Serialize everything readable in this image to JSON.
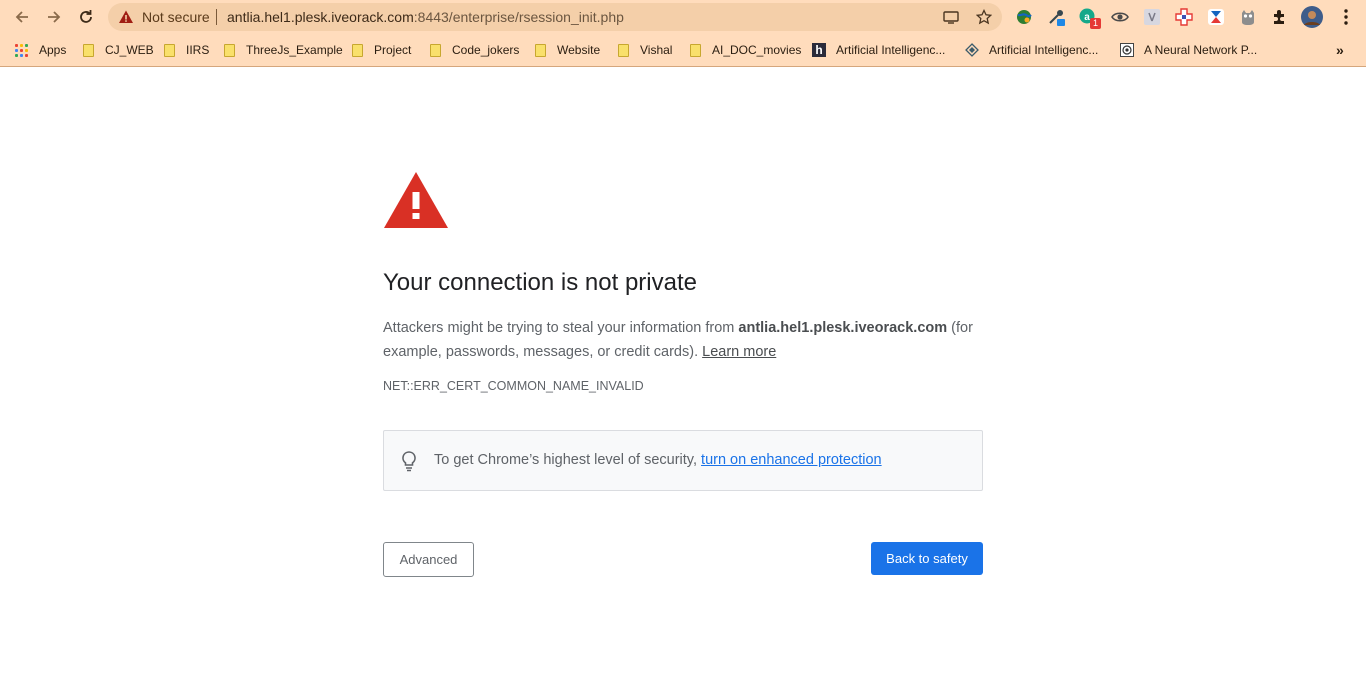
{
  "browser": {
    "security_label": "Not secure",
    "url_host": "antlia.hel1.plesk.iveorack.com",
    "url_path": ":8443/enterprise/rsession_init.php",
    "extension_badge_count": "1"
  },
  "bookmarks": [
    {
      "label": "Apps",
      "icon": "apps-grid-icon"
    },
    {
      "label": "CJ_WEB",
      "icon": "folder-icon"
    },
    {
      "label": "IIRS",
      "icon": "folder-icon"
    },
    {
      "label": "ThreeJs_Example",
      "icon": "folder-icon"
    },
    {
      "label": "Project",
      "icon": "folder-icon"
    },
    {
      "label": "Code_jokers",
      "icon": "folder-icon"
    },
    {
      "label": "Website",
      "icon": "folder-icon"
    },
    {
      "label": "Vishal",
      "icon": "folder-icon"
    },
    {
      "label": "AI_DOC_movies",
      "icon": "folder-icon"
    },
    {
      "label": "Artificial Intelligenc...",
      "icon": "h-favicon"
    },
    {
      "label": "Artificial Intelligenc...",
      "icon": "diamond-favicon"
    },
    {
      "label": "A Neural Network P...",
      "icon": "spiral-favicon"
    }
  ],
  "page": {
    "title": "Your connection is not private",
    "desc_prefix": "Attackers might be trying to steal your information from ",
    "desc_host": "antlia.hel1.plesk.iveorack.com",
    "desc_suffix": " (for example, passwords, messages, or credit cards). ",
    "learn_more": "Learn more",
    "error_code": "NET::ERR_CERT_COMMON_NAME_INVALID",
    "tip_prefix": "To get Chrome’s highest level of security, ",
    "tip_link": "turn on enhanced protection",
    "advanced_button": "Advanced",
    "back_button": "Back to safety"
  },
  "colors": {
    "accent_blue": "#1a73e8",
    "warning_red": "#d93025",
    "toolbar_peach": "#ffdcbc"
  }
}
